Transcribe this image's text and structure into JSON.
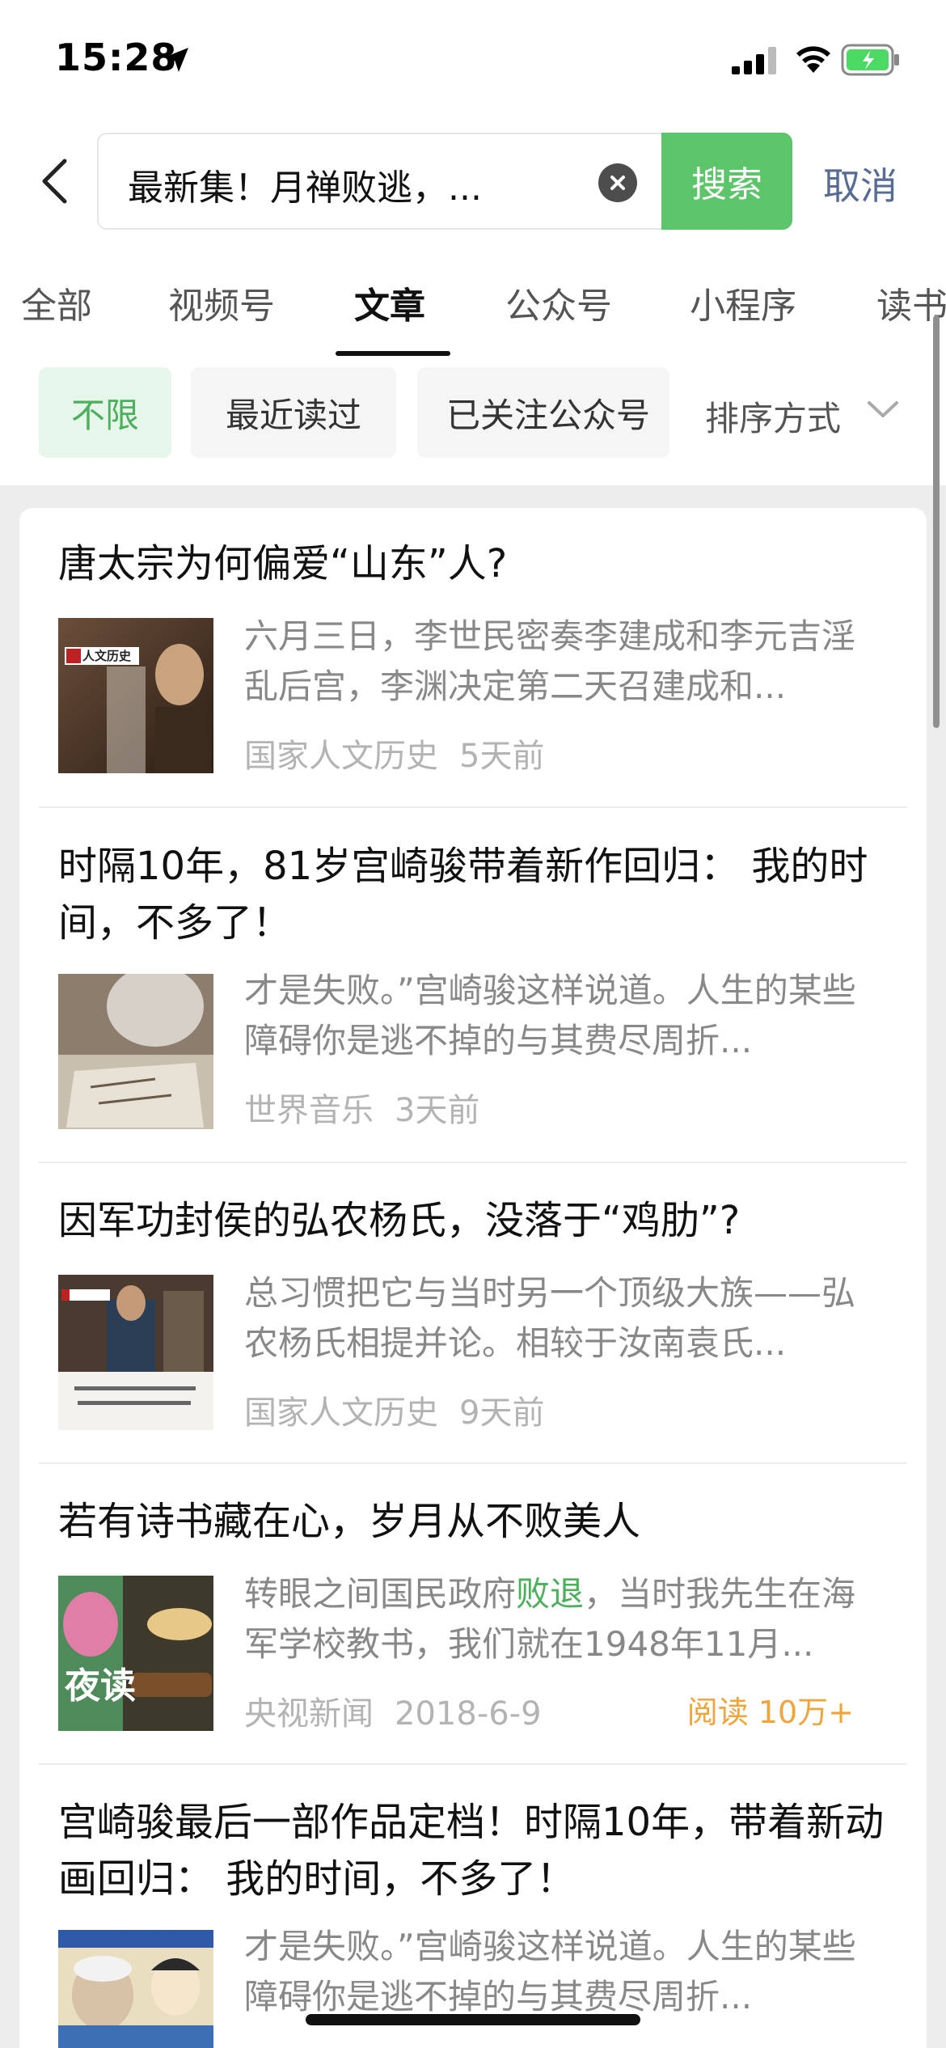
{
  "status": {
    "time": "15:28"
  },
  "search": {
    "query": "最新集！月禅败逃，...",
    "search_label": "搜索",
    "cancel_label": "取消"
  },
  "tabs": [
    {
      "label": "全部"
    },
    {
      "label": "视频号"
    },
    {
      "label": "文章",
      "active": true
    },
    {
      "label": "公众号"
    },
    {
      "label": "小程序"
    },
    {
      "label": "读书"
    }
  ],
  "filters": {
    "chips": [
      {
        "label": "不限",
        "active": true
      },
      {
        "label": "最近读过"
      },
      {
        "label": "已关注公众号"
      }
    ],
    "sort_label": "排序方式"
  },
  "articles": [
    {
      "title": "唐太宗为何偏爱“山东”人?",
      "snippet_before": "六月三日，李世民密奏李建成和李元吉淫乱后宫，李渊决定第二天召建成和...",
      "snippet_hl": "",
      "snippet_after": "",
      "source": "国家人文历史",
      "time": "5天前",
      "reads": "",
      "thumb_text": "人文历史"
    },
    {
      "title": "时隔10年，81岁宫崎骏带着新作回归： 我的时间，不多了！",
      "snippet_before": "才是失败。”宫崎骏这样说道。人生的某些障碍你是逃不掉的与其费尽周折...",
      "snippet_hl": "",
      "snippet_after": "",
      "source": "世界音乐",
      "time": "3天前",
      "reads": "",
      "thumb_text": ""
    },
    {
      "title": "因军功封侯的弘农杨氏，没落于“鸡肋”?",
      "snippet_before": "总习惯把它与当时另一个顶级大族——弘农杨氏相提并论。相较于汝南袁氏...",
      "snippet_hl": "",
      "snippet_after": "",
      "source": "国家人文历史",
      "time": "9天前",
      "reads": "",
      "thumb_text": "人文历史"
    },
    {
      "title": "若有诗书藏在心，岁月从不败美人",
      "snippet_before": "转眼之间国民政府",
      "snippet_hl": "败退",
      "snippet_after": "，当时我先生在海军学校教书，我们就在1948年11月...",
      "source": "央视新闻",
      "time": "2018-6-9",
      "reads": "阅读 10万+",
      "thumb_text": "夜读"
    },
    {
      "title": "宫崎骏最后一部作品定档！时隔10年，带着新动画回归： 我的时间，不多了！",
      "snippet_before": "才是失败。”宫崎骏这样说道。人生的某些障碍你是逃不掉的与其费尽周折...",
      "snippet_hl": "",
      "snippet_after": "",
      "source": "",
      "time": "",
      "reads": "",
      "thumb_text": ""
    }
  ],
  "colors": {
    "accent_green": "#5cc469",
    "link_blue": "#576b95",
    "reads_orange": "#f0a43c"
  }
}
